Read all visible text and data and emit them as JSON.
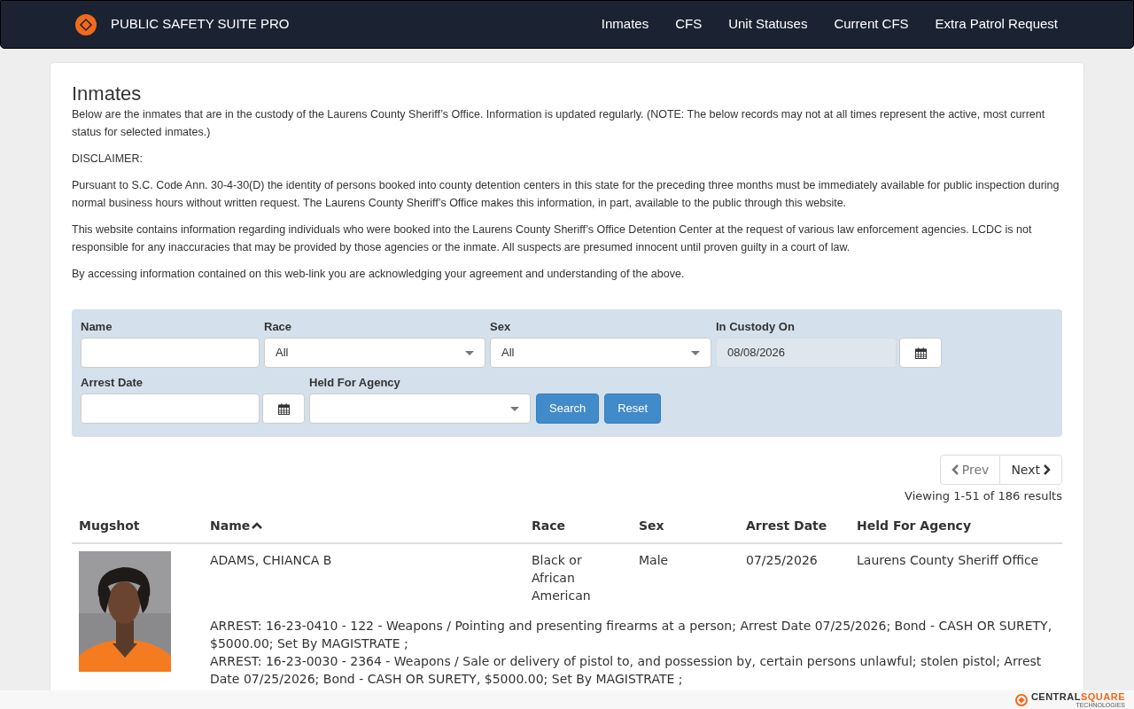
{
  "navbar": {
    "brand": "PUBLIC SAFETY SUITE PRO",
    "links": [
      {
        "label": "Inmates"
      },
      {
        "label": "CFS"
      },
      {
        "label": "Unit Statuses"
      },
      {
        "label": "Current CFS"
      },
      {
        "label": "Extra Patrol Request"
      }
    ]
  },
  "page": {
    "title": "Inmates",
    "paragraphs": [
      "Below are the inmates that are in the custody of the Laurens County Sheriff’s Office. Information is updated regularly. (NOTE: The below records may not at all times represent the active, most current status for selected inmates.)",
      "DISCLAIMER:",
      "Pursuant to S.C. Code Ann. 30-4-30(D) the identity of persons booked into county detention centers in this state for the preceding three months must be immediately available for public inspection during normal business hours without written request. The Laurens County Sheriff’s Office makes this information, in part, available to the public through this website.",
      "This website contains information regarding individuals who were booked into the Laurens County Sheriff’s Office Detention Center at the request of various law enforcement agencies. LCDC is not responsible for any inaccuracies that may be provided by those agencies or the inmate.  All suspects are presumed innocent until proven guilty in a court of law.",
      "By accessing information contained on this web-link you are acknowledging your agreement and understanding of the above."
    ]
  },
  "filters": {
    "rows": [
      [
        {
          "kind": "text",
          "label": "Name"
        },
        {
          "kind": "select",
          "label": "Race",
          "value": "All"
        },
        {
          "kind": "select",
          "label": "Sex",
          "value": "All"
        },
        {
          "kind": "date",
          "label": "In Custody On",
          "value": "08/08/2026",
          "readonly": true
        }
      ],
      [
        {
          "kind": "date",
          "label": "Arrest Date",
          "readonly": false
        },
        {
          "kind": "select",
          "label": "Held For Agency"
        }
      ]
    ],
    "buttons": [
      "Search",
      "Reset"
    ]
  },
  "pagination": {
    "prev": {
      "label": "Prev",
      "disabled": true
    },
    "next": {
      "label": "Next",
      "disabled": false
    },
    "summary": "Viewing 1-51 of 186 results"
  },
  "table": {
    "columns": [
      {
        "label": "Mugshot",
        "sorted": false
      },
      {
        "label": "Name",
        "sorted": true
      },
      {
        "label": "Race",
        "sorted": false
      },
      {
        "label": "Sex",
        "sorted": false
      },
      {
        "label": "Arrest Date",
        "sorted": false
      },
      {
        "label": "Held For Agency",
        "sorted": false
      }
    ],
    "rows": [
      {
        "name": "ADAMS, CHIANCA B",
        "race": "Black or African American",
        "sex": "Male",
        "arrest_date": "07/25/2026",
        "agency": "Laurens County Sheriff Office",
        "charges": [
          "ARREST: 16-23-0410 - 122 - Weapons / Pointing and presenting firearms at a person; Arrest Date 07/25/2026; Bond - CASH OR SURETY, $5000.00; Set By MAGISTRATE ;",
          "ARREST: 16-23-0030 - 2364 - Weapons / Sale or delivery of pistol to, and possession by, certain persons unlawful; stolen pistol; Arrest Date 07/25/2026; Bond - CASH OR SURETY, $5000.00; Set By MAGISTRATE ;"
        ]
      }
    ]
  },
  "footer": {
    "brand_part_1": "CENTRAL",
    "brand_part_2": "SQUARE",
    "tagline": "TECHNOLOGIES"
  }
}
